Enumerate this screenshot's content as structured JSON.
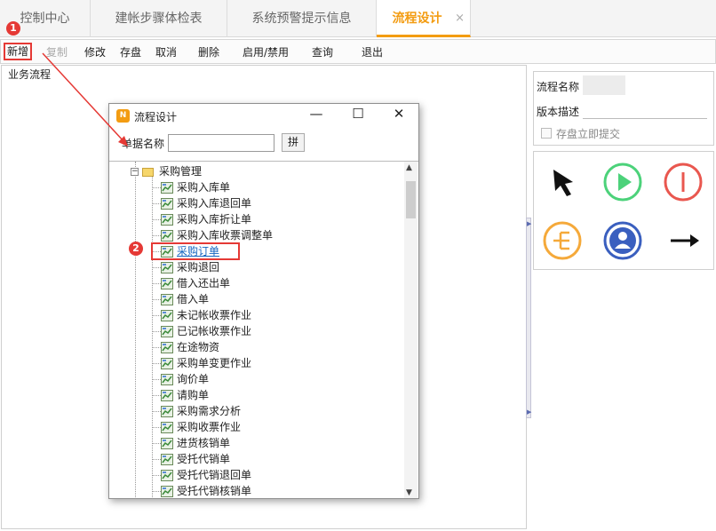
{
  "tabs": [
    {
      "label": "控制中心"
    },
    {
      "label": "建帐步骤体检表"
    },
    {
      "label": "系统预警提示信息"
    },
    {
      "label": "流程设计",
      "close": "×"
    }
  ],
  "toolbar": {
    "add": "新增",
    "copy": "复制",
    "modify": "修改",
    "save": "存盘",
    "cancel": "取消",
    "delete": "删除",
    "enable_disable": "启用/禁用",
    "query": "查询",
    "exit": "退出"
  },
  "left_panel": {
    "title": "业务流程"
  },
  "properties": {
    "flow_name_label": "流程名称",
    "version_desc_label": "版本描述",
    "submit_on_save_label": "存盘立即提交"
  },
  "palette": {
    "icons": [
      "pointer-arrow-icon",
      "start-play-icon",
      "end-stop-icon",
      "branch-icon",
      "user-node-icon",
      "connector-arrow-icon"
    ]
  },
  "colors": {
    "accent": "#f39c12",
    "start": "#4cd27a",
    "end": "#e9574f",
    "branch": "#f5a93a",
    "user": "#3a5fbf",
    "annotation": "#e53935"
  },
  "dialog": {
    "title": "流程设计",
    "minimize": "—",
    "maximize": "☐",
    "close": "✕",
    "doc_name_label": "单据名称",
    "doc_name_value": "",
    "pinyin_button": "拼",
    "tree": {
      "root": "采购管理",
      "items": [
        "采购入库单",
        "采购入库退回单",
        "采购入库折让单",
        "采购入库收票调整单",
        "采购订单",
        "采购退回",
        "借入还出单",
        "借入单",
        "未记帐收票作业",
        "已记帐收票作业",
        "在途物资",
        "采购单变更作业",
        "询价单",
        "请购单",
        "采购需求分析",
        "采购收票作业",
        "进货核销单",
        "受托代销单",
        "受托代销退回单",
        "受托代销核销单"
      ]
    }
  },
  "annotations": {
    "step1": "1",
    "step2": "2"
  }
}
